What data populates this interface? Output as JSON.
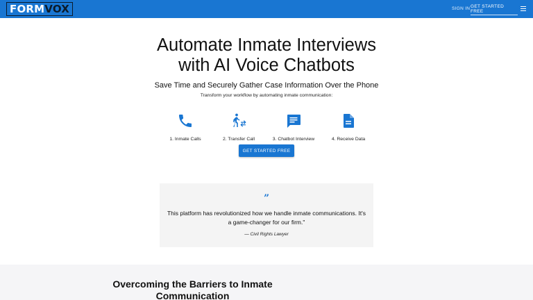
{
  "header": {
    "logo_part1": "FORM",
    "logo_part2": "VOX",
    "sign_in": "SIGN IN",
    "get_started": "GET STARTED FREE"
  },
  "hero": {
    "title_line1": "Automate Inmate Interviews",
    "title_line2": "with AI Voice Chatbots",
    "subtitle": "Save Time and Securely Gather Case Information Over the Phone",
    "small": "Transform your workflow by automating inmate communication:"
  },
  "steps": [
    {
      "label": "1. Inmate Calls",
      "icon": "phone-icon"
    },
    {
      "label": "2. Transfer Call",
      "icon": "transfer-call-icon"
    },
    {
      "label": "3. Chatbot Interview",
      "icon": "chat-icon"
    },
    {
      "label": "4. Receive Data",
      "icon": "document-icon"
    }
  ],
  "cta": "GET STARTED FREE",
  "testimonial": {
    "mark": "”",
    "text": "This platform has revolutionized how we handle inmate communications. It's a game-changer for our firm.\"",
    "author": "— Civil Rights Lawyer"
  },
  "section": {
    "title": "Overcoming the Barriers to Inmate Communication"
  },
  "colors": {
    "brand": "#1976d2",
    "card": "#f4f4f4",
    "band": "#f5f5f7"
  }
}
